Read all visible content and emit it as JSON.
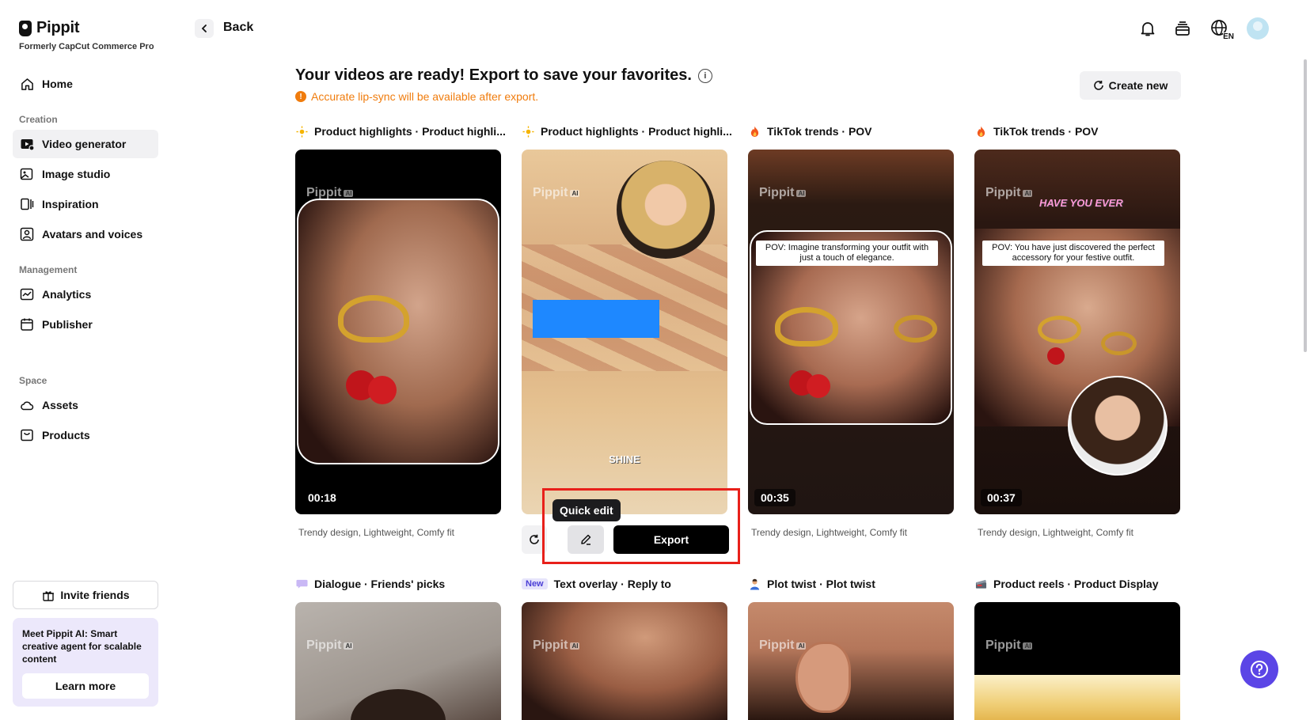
{
  "brand": {
    "name": "Pippit",
    "subtitle": "Formerly CapCut Commerce Pro"
  },
  "sidebar": {
    "home": "Home",
    "sections": {
      "creation": "Creation",
      "management": "Management",
      "space": "Space"
    },
    "items": {
      "video_generator": "Video generator",
      "image_studio": "Image studio",
      "inspiration": "Inspiration",
      "avatars_voices": "Avatars and voices",
      "analytics": "Analytics",
      "publisher": "Publisher",
      "assets": "Assets",
      "products": "Products"
    },
    "invite": "Invite friends",
    "promo": {
      "text": "Meet Pippit AI: Smart creative agent for scalable content",
      "button": "Learn more"
    }
  },
  "topbar": {
    "back": "Back",
    "language": "EN"
  },
  "header": {
    "title": "Your videos are ready! Export to save your favorites.",
    "warning": "Accurate lip-sync will be available after export.",
    "create_new": "Create new"
  },
  "watermark": "Pippit",
  "watermark_badge": "AI",
  "cards": [
    {
      "title": "Product highlights · Product highli...",
      "duration": "00:18",
      "tags": "Trendy design, Lightweight, Comfy fit"
    },
    {
      "title": "Product highlights · Product highli...",
      "overlay": "SHINE"
    },
    {
      "title": "TikTok trends · POV",
      "duration": "00:35",
      "caption": "POV: Imagine transforming your outfit with just a touch of elegance.",
      "tags": "Trendy design, Lightweight, Comfy fit"
    },
    {
      "title": "TikTok trends · POV",
      "duration": "00:37",
      "caption": "POV: You have just discovered the perfect accessory for your festive outfit.",
      "overlay": "HAVE YOU EVER",
      "tags": "Trendy design, Lightweight, Comfy fit"
    },
    {
      "title": "Dialogue · Friends' picks"
    },
    {
      "title": "Text overlay · Reply to",
      "badge": "New"
    },
    {
      "title": "Plot twist · Plot twist"
    },
    {
      "title": "Product reels · Product Display"
    }
  ],
  "actions": {
    "quick_edit": "Quick edit",
    "export": "Export"
  },
  "colors": {
    "accent": "#5b45e6",
    "warning": "#f07c0d",
    "highlight_box": "#e8201a"
  }
}
